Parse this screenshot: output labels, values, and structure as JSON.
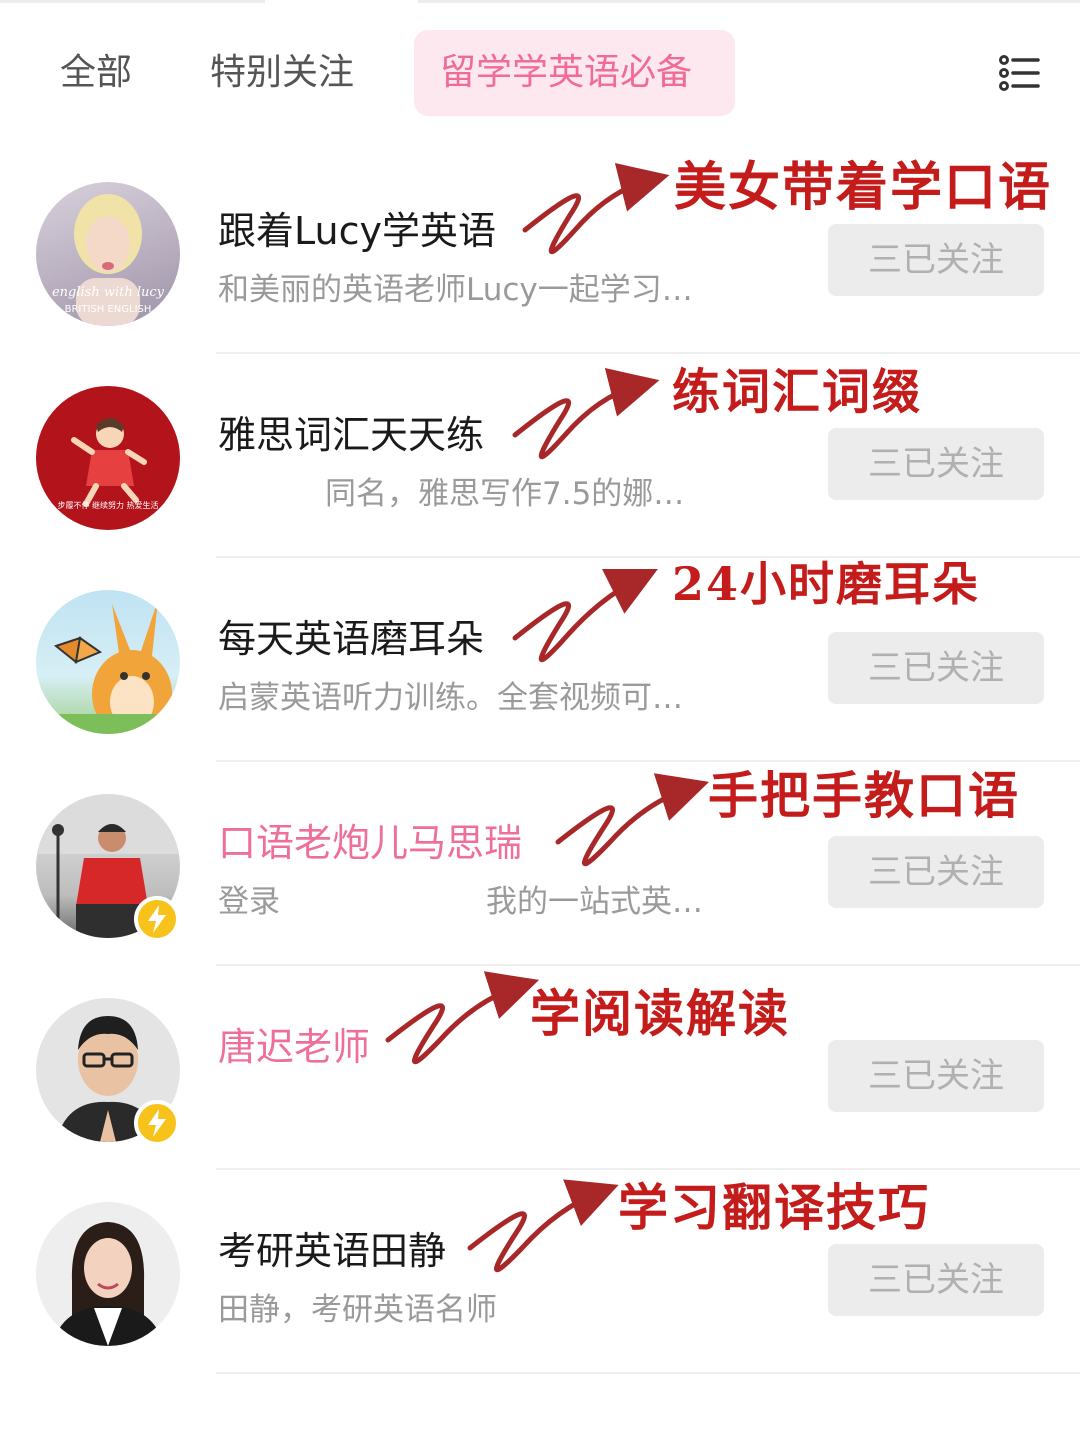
{
  "colors": {
    "accent_pink": "#f06b96",
    "annotation_red": "#c41b1b",
    "button_bg": "#ececec",
    "button_text": "#b0b0b0",
    "badge_yellow": "#f7c21a"
  },
  "tabs": [
    {
      "label": "全部",
      "active": false
    },
    {
      "label": "特别关注",
      "active": false
    },
    {
      "label": "留学学英语必备",
      "active": true
    }
  ],
  "menu_icon": "list-menu-icon",
  "accounts": [
    {
      "name": "跟着Lucy学英语",
      "description": "和美丽的英语老师Lucy一起学习…",
      "follow_label": "三已关注",
      "annotation": "美女带着学口语",
      "name_highlight": false,
      "verified_badge": false,
      "avatar_text": [
        "english with lucy",
        "BRITISH ENGLISH"
      ]
    },
    {
      "name": "雅思词汇天天练",
      "description": "同名，雅思写作7.5的娜…",
      "follow_label": "三已关注",
      "annotation": "练词汇词缀",
      "name_highlight": false,
      "verified_badge": false,
      "avatar_text": [
        "步履不停 继续努力 热爱生活"
      ]
    },
    {
      "name": "每天英语磨耳朵",
      "description": "启蒙英语听力训练。全套视频可…",
      "follow_label": "三已关注",
      "annotation": "24小时磨耳朵",
      "name_highlight": false,
      "verified_badge": false
    },
    {
      "name": "口语老炮儿马思瑞",
      "description_left": "登录",
      "description_right": "我的一站式英…",
      "follow_label": "三已关注",
      "annotation": "手把手教口语",
      "name_highlight": true,
      "verified_badge": true
    },
    {
      "name": "唐迟老师",
      "description": "",
      "follow_label": "三已关注",
      "annotation": "学阅读解读",
      "name_highlight": true,
      "verified_badge": true
    },
    {
      "name": "考研英语田静",
      "description": "田静，考研英语名师",
      "follow_label": "三已关注",
      "annotation": "学习翻译技巧",
      "name_highlight": false,
      "verified_badge": false
    }
  ]
}
